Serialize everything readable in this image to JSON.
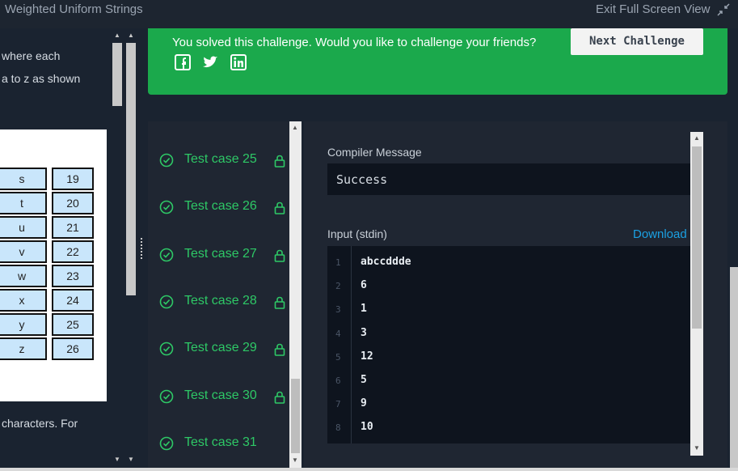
{
  "topbar": {
    "title": "Weighted Uniform Strings",
    "exit_label": "Exit Full Screen View"
  },
  "left_pane": {
    "lines": [
      "where each",
      "a to z as shown",
      "characters. For"
    ],
    "table": [
      {
        "letter": "s",
        "value": "19"
      },
      {
        "letter": "t",
        "value": "20"
      },
      {
        "letter": "u",
        "value": "21"
      },
      {
        "letter": "v",
        "value": "22"
      },
      {
        "letter": "w",
        "value": "23"
      },
      {
        "letter": "x",
        "value": "24"
      },
      {
        "letter": "y",
        "value": "25"
      },
      {
        "letter": "z",
        "value": "26"
      }
    ]
  },
  "banner": {
    "message": "You solved this challenge. Would you like to challenge your friends?",
    "next_label": "Next Challenge",
    "social": [
      "facebook",
      "twitter",
      "linkedin"
    ]
  },
  "test_cases": [
    {
      "label": "Test case 25",
      "locked": true
    },
    {
      "label": "Test case 26",
      "locked": true
    },
    {
      "label": "Test case 27",
      "locked": true
    },
    {
      "label": "Test case 28",
      "locked": true
    },
    {
      "label": "Test case 29",
      "locked": true
    },
    {
      "label": "Test case 30",
      "locked": true
    },
    {
      "label": "Test case 31",
      "locked": false
    }
  ],
  "output": {
    "compiler_label": "Compiler Message",
    "compiler_message": "Success",
    "input_label": "Input (stdin)",
    "download_label": "Download",
    "input_lines": [
      {
        "n": "1",
        "v": "abccddde"
      },
      {
        "n": "2",
        "v": "6"
      },
      {
        "n": "3",
        "v": "1"
      },
      {
        "n": "4",
        "v": "3"
      },
      {
        "n": "5",
        "v": "12"
      },
      {
        "n": "6",
        "v": "5"
      },
      {
        "n": "7",
        "v": "9"
      },
      {
        "n": "8",
        "v": "10"
      }
    ]
  },
  "colors": {
    "success_green": "#1ba94c",
    "pass_green": "#2ec866",
    "link_blue": "#1ba0e2"
  }
}
